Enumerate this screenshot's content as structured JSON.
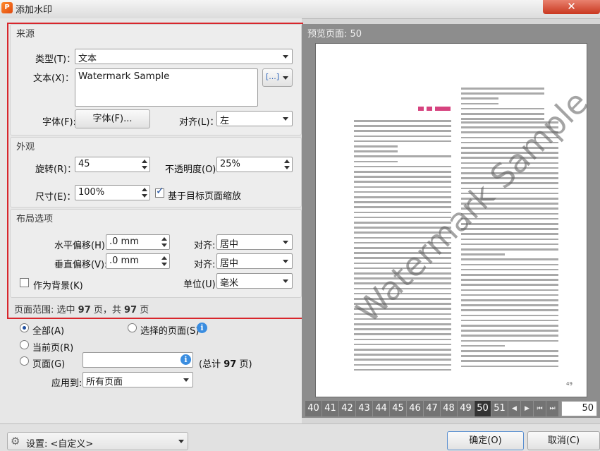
{
  "window": {
    "title": "添加水印",
    "close_glyph": "✕"
  },
  "source": {
    "header": "来源",
    "type_label": "类型(T)：",
    "type_value": "文本",
    "text_label": "文本(X)：",
    "text_value": "Watermark Sample",
    "insert_button_glyph": "[...]",
    "font_label": "字体(F):",
    "font_button": "字体(F)...",
    "align_label": "对齐(L)：",
    "align_value": "左"
  },
  "appearance": {
    "header": "外观",
    "rotation_label": "旋转(R)：",
    "rotation_value": "45",
    "opacity_label": "不透明度(O):",
    "opacity_value": "25%",
    "size_label": "尺寸(E)：",
    "size_value": "100%",
    "scale_label": "基于目标页面缩放",
    "scale_checked": true
  },
  "layout": {
    "header": "布局选项",
    "h_offset_label": "水平偏移(H):",
    "h_offset_value": ".0 mm",
    "h_align_label": "对齐:",
    "h_align_value": "居中",
    "v_offset_label": "垂直偏移(V):",
    "v_offset_value": ".0 mm",
    "v_align_label": "对齐:",
    "v_align_value": "居中",
    "background_label": "作为背景(K)",
    "unit_label": "单位(U):",
    "unit_value": "毫米"
  },
  "page_range": {
    "prefix": "页面范围: 选中",
    "selected_count": "97",
    "middle": "页，共",
    "total_count": "97",
    "suffix": "页",
    "all_label": "全部(A)",
    "selected_pages_label": "选择的页面(S)",
    "current_label": "当前页(R)",
    "pages_label": "页面(G)",
    "pages_value": "",
    "total_prefix": "(总计",
    "total_value": "97",
    "total_suffix": "页)",
    "apply_label": "应用到:",
    "apply_value": "所有页面",
    "info_glyph": "i"
  },
  "preview": {
    "label": "预览页面:",
    "page_number": "50",
    "watermark_text": "Watermark Sample",
    "footer_page": "49",
    "tabs": [
      "40",
      "41",
      "42",
      "43",
      "44",
      "45",
      "46",
      "47",
      "48",
      "49",
      "50",
      "51"
    ],
    "selected_tab": "50",
    "nav_glyphs": [
      "◀",
      "▶",
      "⏮",
      "⏭"
    ],
    "page_input": "50"
  },
  "bottom": {
    "settings_label": "设置: <自定义>",
    "ok_label": "确定(O)",
    "cancel_label": "取消(C)"
  },
  "colors": {
    "highlight_border": "#d8262c",
    "accent_pink": "#d6437f",
    "selected_tab": "#333333"
  }
}
